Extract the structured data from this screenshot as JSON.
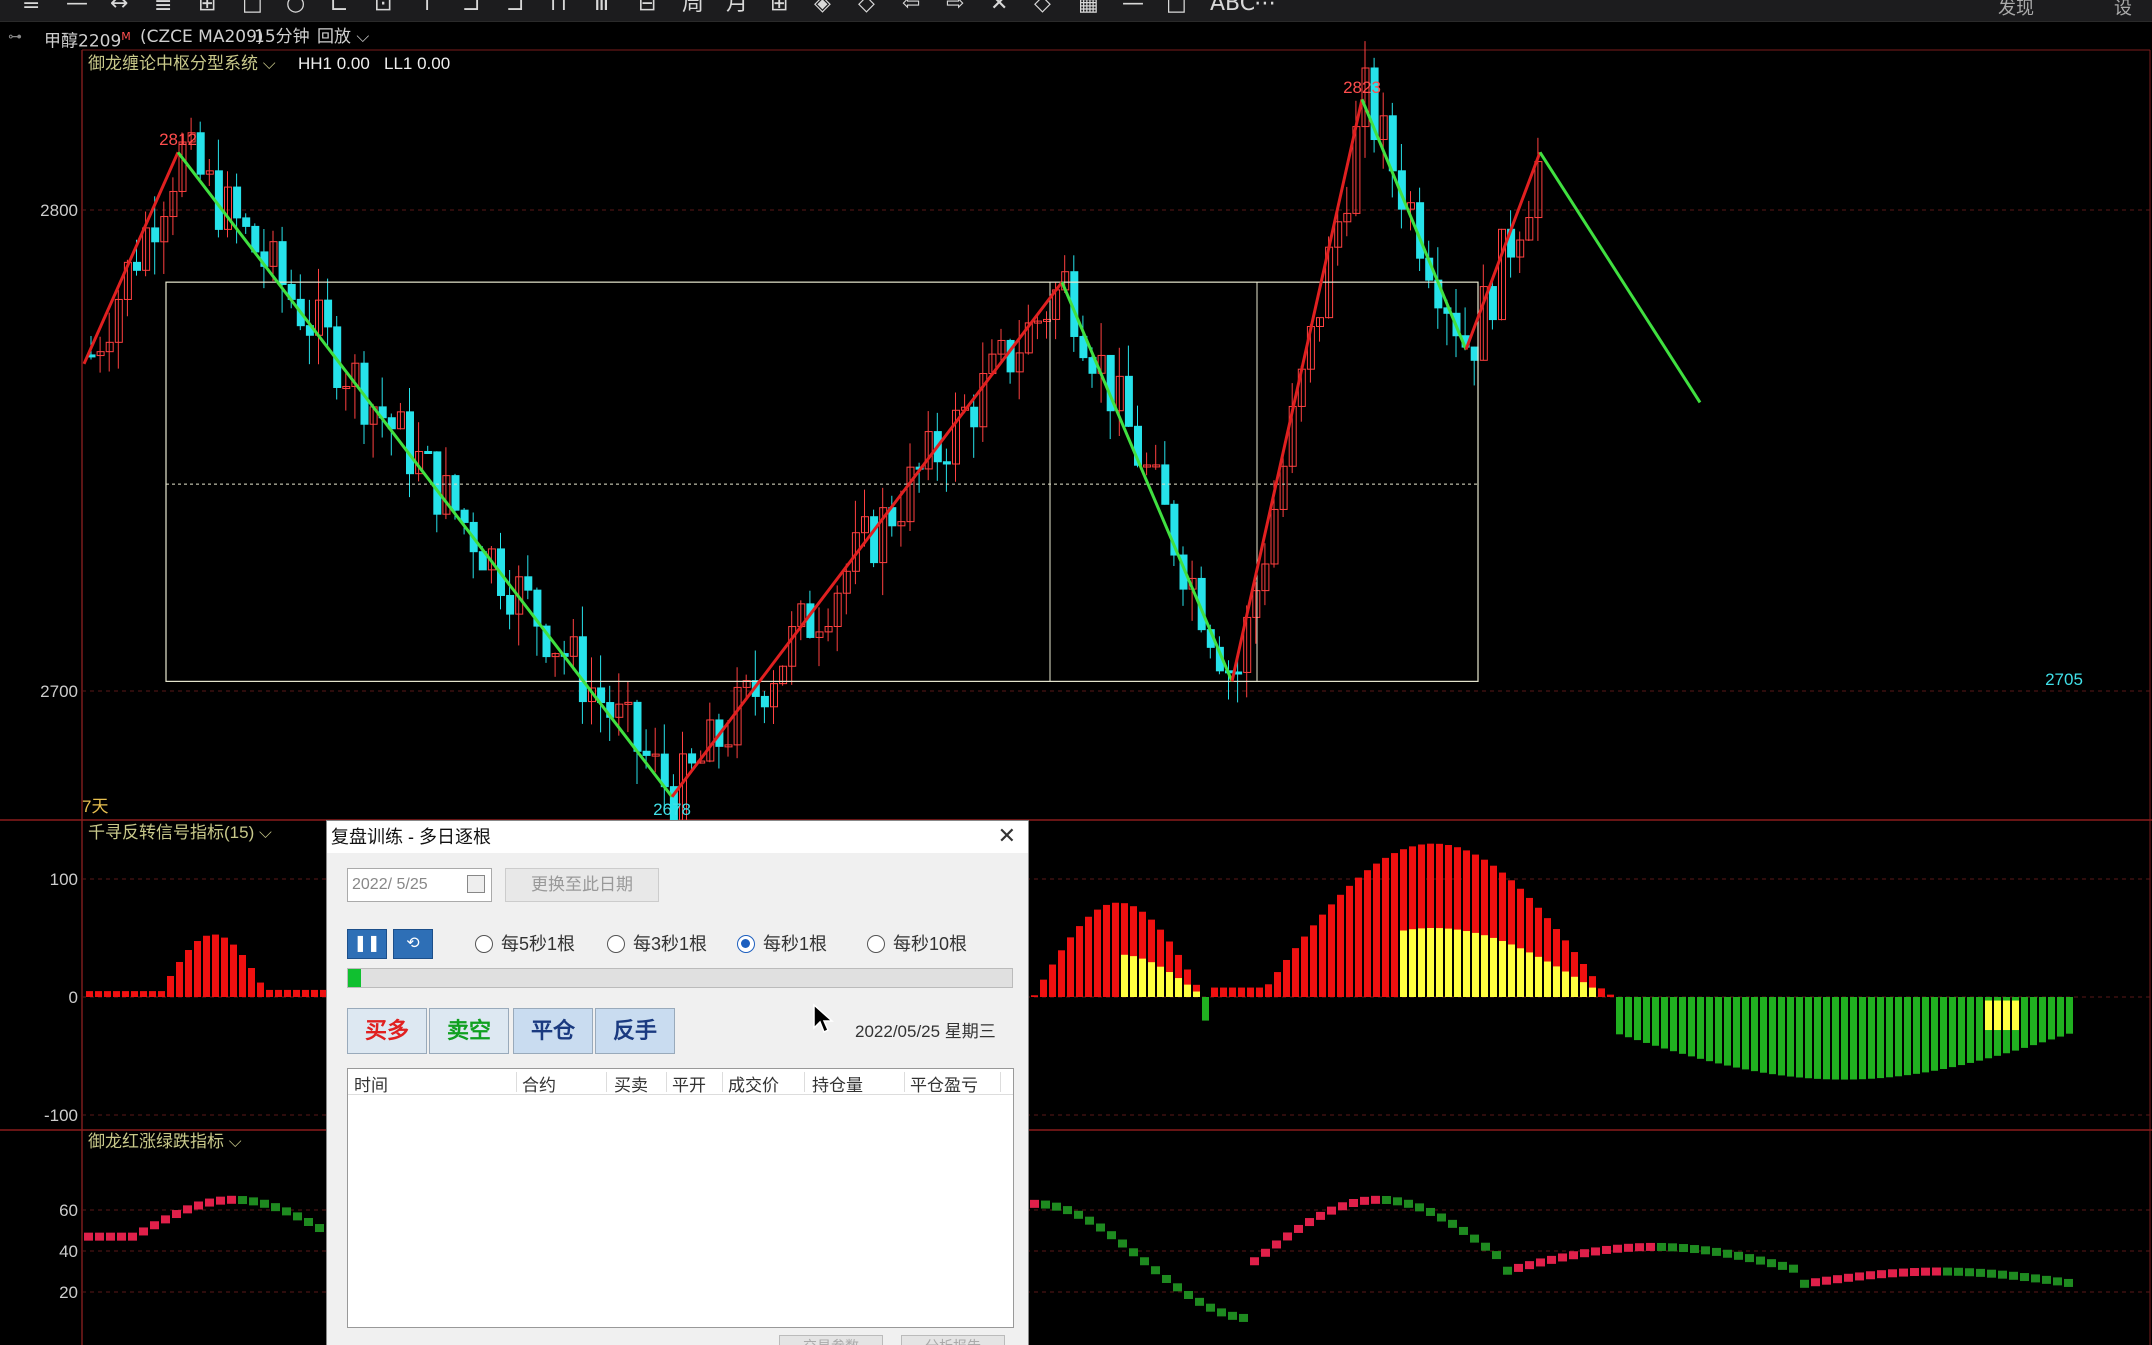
{
  "toolbar": {
    "icons": [
      "≡",
      "—",
      "↔",
      "≣",
      "⊞",
      "□",
      "○",
      "⊏",
      "⊡",
      "↑",
      "⊐",
      "⊐",
      "⊓",
      "Ⅲ",
      "⊟",
      "周",
      "月",
      "⊞",
      "◈",
      "◇",
      "⇦",
      "⇨",
      "✕",
      "◇",
      "▦",
      "—",
      "□",
      "ABC",
      "⋯"
    ],
    "right_label_1": "发现",
    "right_label_2": "设"
  },
  "infobar": {
    "symbol": "甲醇2209",
    "symbol_sup": "M",
    "code": "(CZCE MA209)",
    "period": "15分钟",
    "mode": "回放"
  },
  "main_panel": {
    "indicator_name": "御龙缠论中枢分型系统",
    "hh_label": "HH1 0.00",
    "ll_label": "LL1 0.00",
    "y_ticks": [
      "2800",
      "2700"
    ],
    "peak_labels": [
      "2812",
      "2678",
      "2823",
      "2705"
    ],
    "bottom_left_label": "7天",
    "zhongshu": {
      "upper": 2785,
      "lower": 2702,
      "middle": 2743
    }
  },
  "panel2": {
    "indicator_name": "千寻反转信号指标(15)",
    "y_ticks": [
      "100",
      "0",
      "-100"
    ]
  },
  "panel3": {
    "indicator_name": "御龙红涨绿跌指标",
    "y_ticks": [
      "60",
      "40",
      "20"
    ]
  },
  "colors": {
    "up_bar": "#ff4040",
    "down_bar": "#26e2ea",
    "up_line": "#e02020",
    "down_line": "#40e040",
    "red_hist": "#f01010",
    "yellow_hist": "#ffff40",
    "green_hist": "#20b020"
  },
  "dialog": {
    "title": "复盘训练 - 多日逐根",
    "date_value": "2022/ 5/25",
    "change_date_label": "更换至此日期",
    "pause_icon": "pause-icon",
    "loop_icon": "loop-icon",
    "speed_options": [
      "每5秒1根",
      "每3秒1根",
      "每秒1根",
      "每秒10根"
    ],
    "selected_speed": "每秒1根",
    "progress": 0.02,
    "buy_long": "买多",
    "sell_short": "卖空",
    "close_pos": "平仓",
    "reverse": "反手",
    "current_time": "2022/05/25 星期三",
    "table_columns": [
      "时间",
      "合约",
      "买卖",
      "平开",
      "成交价",
      "持仓量",
      "平仓盈亏"
    ],
    "footer_btn1": "交易参数",
    "footer_btn2": "分析报告"
  }
}
